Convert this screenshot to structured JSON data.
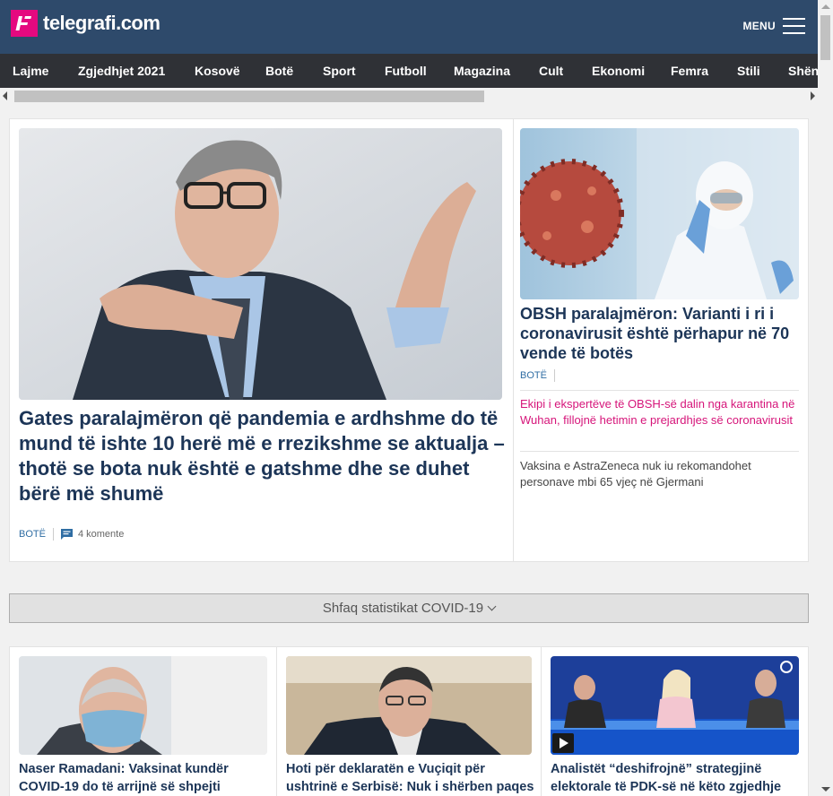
{
  "header": {
    "logo_text": "telegrafi.com",
    "menu_label": "MENU"
  },
  "nav": {
    "items": [
      "Lajme",
      "Zgjedhjet 2021",
      "Kosovë",
      "Botë",
      "Sport",
      "Futboll",
      "Magazina",
      "Cult",
      "Ekonomi",
      "Femra",
      "Stili",
      "Shën"
    ]
  },
  "main": {
    "hero": {
      "title": "Gates paralajmëron që pandemia e ardhshme do të mund të ishte 10 herë më e rrezikshme se aktualja – thotë se bota nuk është e gatshme dhe se duhet bërë më shumë",
      "category": "BOTË",
      "comments": "4 komente",
      "image_alt": "Bill Gates speaking"
    },
    "side": {
      "title": "OBSH paralajmëron: Varianti i ri i coronavirusit është përhapur në 70 vende të botës",
      "category": "BOTË",
      "image_alt": "Scientist in protective suit with virus illustration",
      "related": [
        "Ekipi i ekspertëve të OBSH-së dalin nga karantina në Wuhan, fillojnë hetimin e prejardhjes së coronavirusit",
        "Vaksina e AstraZeneca nuk iu rekomandohet personave mbi 65 vjeç në Gjermani"
      ]
    }
  },
  "covid": {
    "label": "Shfaq statistikat COVID-19"
  },
  "cards": [
    {
      "title": "Naser Ramadani: Vaksinat kundër COVID-19 do të arrijnë së shpejti"
    },
    {
      "title": "Hoti për deklaratën e Vuçiqit për ushtrinë e Serbisë: Nuk i shërben paqes"
    },
    {
      "title": "Analistët “deshifrojnë” strategjinë elektorale të PDK-së në këto zgjedhje"
    }
  ],
  "colors": {
    "header_bg": "#2e4a6b",
    "nav_bg": "#2f3136",
    "brand_pink": "#e5097f",
    "title_blue": "#1c3557",
    "link_pink": "#d6157a"
  }
}
